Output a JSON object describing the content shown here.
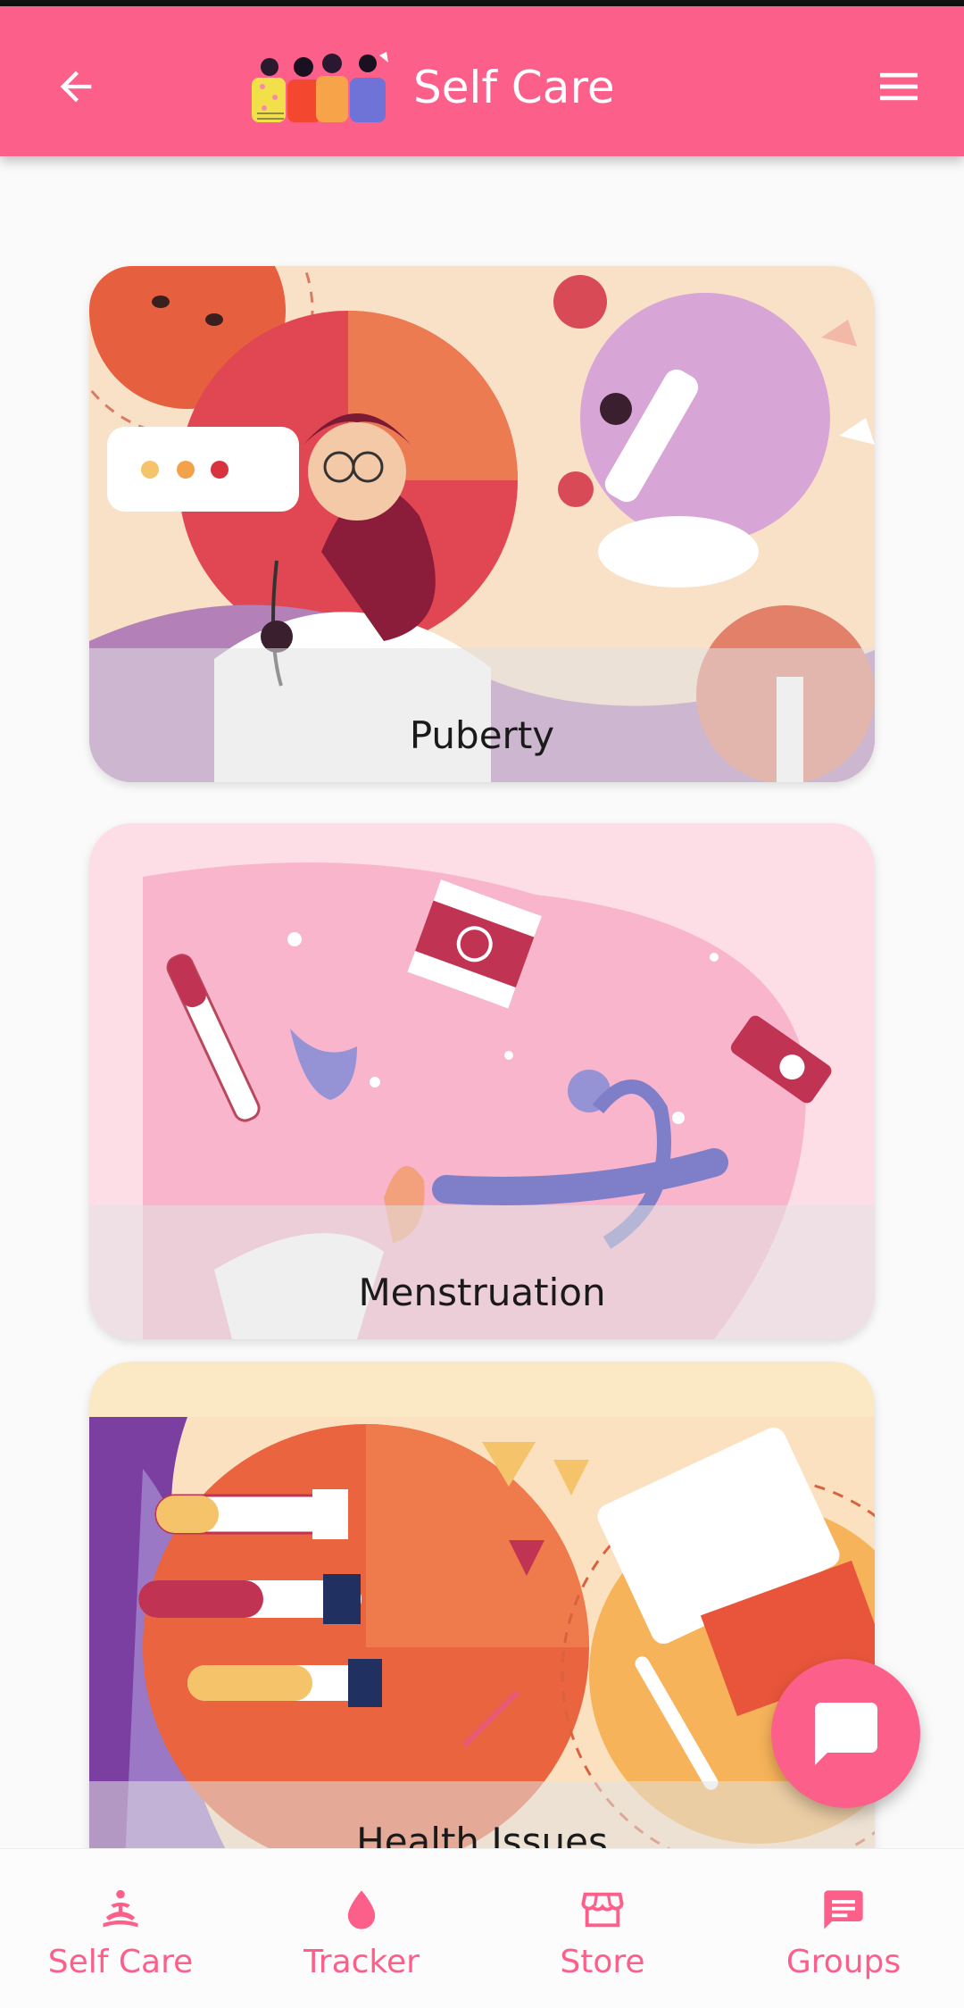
{
  "app_bar": {
    "title": "Self Care"
  },
  "cards": [
    {
      "label": "Puberty"
    },
    {
      "label": "Menstruation"
    },
    {
      "label": "Health Issues"
    }
  ],
  "bottom_nav": {
    "items": [
      {
        "label": "Self Care",
        "icon": "meditation-icon"
      },
      {
        "label": "Tracker",
        "icon": "drop-icon"
      },
      {
        "label": "Store",
        "icon": "store-icon"
      },
      {
        "label": "Groups",
        "icon": "chat-bubble-icon"
      }
    ]
  },
  "colors": {
    "primary": "#fd5f8b",
    "background": "#fafafa"
  }
}
